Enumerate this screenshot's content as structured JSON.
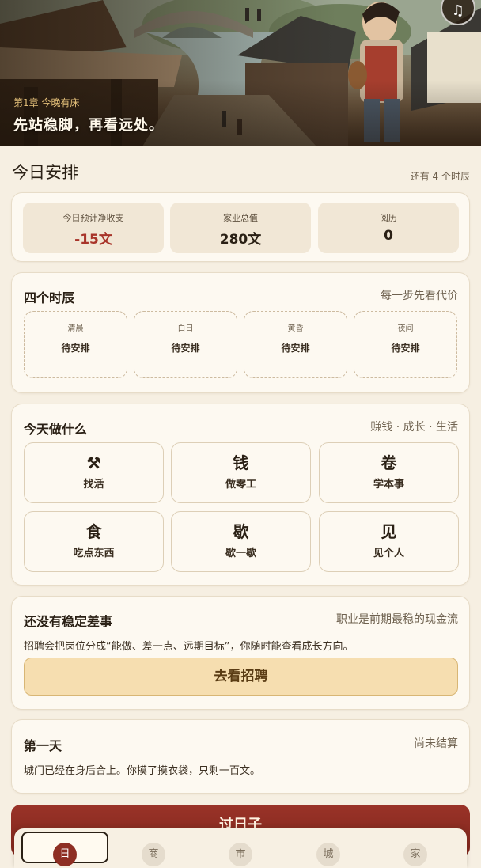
{
  "hero": {
    "chapter": "第1章 今晚有床",
    "title": "先站稳脚，再看远处。",
    "music_icon": "music-note-icon"
  },
  "header": {
    "title": "今日安排",
    "remaining": "还有 4 个时辰"
  },
  "stats": [
    {
      "label": "今日预计净收支",
      "value": "-15文"
    },
    {
      "label": "家业总值",
      "value": "280文"
    },
    {
      "label": "阅历",
      "value": "0"
    }
  ],
  "periods": {
    "title": "四个时辰",
    "hint": "每一步先看代价",
    "slots": [
      {
        "name": "清晨",
        "status": "待安排"
      },
      {
        "name": "白日",
        "status": "待安排"
      },
      {
        "name": "黄昏",
        "status": "待安排"
      },
      {
        "name": "夜间",
        "status": "待安排"
      }
    ]
  },
  "actions": {
    "title": "今天做什么",
    "hint": "赚钱 · 成长 · 生活",
    "items": [
      {
        "glyph": "⚒",
        "label": "找活"
      },
      {
        "glyph": "钱",
        "label": "做零工"
      },
      {
        "glyph": "卷",
        "label": "学本事"
      },
      {
        "glyph": "食",
        "label": "吃点东西"
      },
      {
        "glyph": "歇",
        "label": "歇一歇"
      },
      {
        "glyph": "见",
        "label": "见个人"
      }
    ]
  },
  "job": {
    "title": "还没有稳定差事",
    "hint": "职业是前期最稳的现金流",
    "desc": "招聘会把岗位分成“能做、差一点、远期目标”，你随时能查看成长方向。",
    "button": "去看招聘"
  },
  "day": {
    "title": "第一天",
    "hint": "尚未结算",
    "desc": "城门已经在身后合上。你摸了摸衣袋，只剩一百文。"
  },
  "pass_button": "过日子",
  "nav": [
    {
      "label": "日"
    },
    {
      "label": "商"
    },
    {
      "label": "市"
    },
    {
      "label": "城"
    },
    {
      "label": "家"
    }
  ],
  "colors": {
    "background": "#f6efe2",
    "accent_red": "#8e2e23",
    "negative": "#a8342a",
    "gold": "#e3bf79"
  }
}
